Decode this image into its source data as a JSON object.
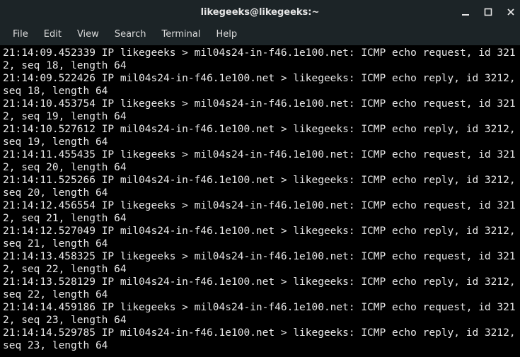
{
  "window": {
    "title": "likegeeks@likegeeks:~"
  },
  "menu": {
    "items": [
      "File",
      "Edit",
      "View",
      "Search",
      "Terminal",
      "Help"
    ]
  },
  "terminal": {
    "host_local": "likegeeks",
    "host_remote": "mil04s24-in-f46.1e100.net",
    "id": 3212,
    "length": 64,
    "lines": [
      {
        "ts": "21:14:09.452339",
        "dir": "request",
        "seq": 18
      },
      {
        "ts": "21:14:09.522426",
        "dir": "reply",
        "seq": 18
      },
      {
        "ts": "21:14:10.453754",
        "dir": "request",
        "seq": 19
      },
      {
        "ts": "21:14:10.527612",
        "dir": "reply",
        "seq": 19
      },
      {
        "ts": "21:14:11.455435",
        "dir": "request",
        "seq": 20
      },
      {
        "ts": "21:14:11.525266",
        "dir": "reply",
        "seq": 20
      },
      {
        "ts": "21:14:12.456554",
        "dir": "request",
        "seq": 21
      },
      {
        "ts": "21:14:12.527049",
        "dir": "reply",
        "seq": 21
      },
      {
        "ts": "21:14:13.458325",
        "dir": "request",
        "seq": 22
      },
      {
        "ts": "21:14:13.528129",
        "dir": "reply",
        "seq": 22
      },
      {
        "ts": "21:14:14.459186",
        "dir": "request",
        "seq": 23
      },
      {
        "ts": "21:14:14.529785",
        "dir": "reply",
        "seq": 23
      }
    ]
  }
}
